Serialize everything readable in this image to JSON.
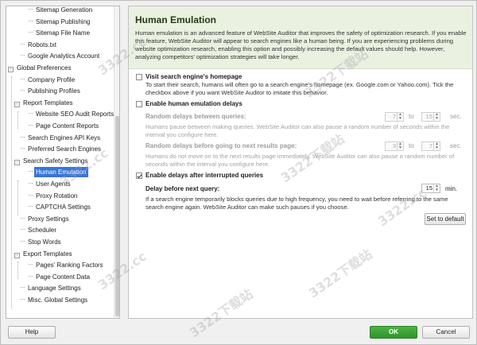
{
  "tree": [
    {
      "label": "Sitemap Generation",
      "indent": 3,
      "toggle": ""
    },
    {
      "label": "Sitemap Publishing",
      "indent": 3,
      "toggle": ""
    },
    {
      "label": "Sitemap File Name",
      "indent": 3,
      "toggle": ""
    },
    {
      "label": "Robots.txt",
      "indent": 2,
      "toggle": ""
    },
    {
      "label": "Google Analytics Account",
      "indent": 2,
      "toggle": ""
    },
    {
      "label": "Global Preferences",
      "indent": 0,
      "toggle": "-"
    },
    {
      "label": "Company Profile",
      "indent": 2,
      "toggle": ""
    },
    {
      "label": "Publishing Profiles",
      "indent": 2,
      "toggle": ""
    },
    {
      "label": "Report Templates",
      "indent": 1,
      "toggle": "-"
    },
    {
      "label": "Website SEO Audit Reports",
      "indent": 3,
      "toggle": ""
    },
    {
      "label": "Page Content Reports",
      "indent": 3,
      "toggle": ""
    },
    {
      "label": "Search Engines API Keys",
      "indent": 2,
      "toggle": ""
    },
    {
      "label": "Preferred Search Engines",
      "indent": 2,
      "toggle": ""
    },
    {
      "label": "Search Safety Settings",
      "indent": 1,
      "toggle": "-"
    },
    {
      "label": "Human Emulation",
      "indent": 3,
      "toggle": "",
      "selected": true
    },
    {
      "label": "User Agents",
      "indent": 3,
      "toggle": ""
    },
    {
      "label": "Proxy Rotation",
      "indent": 3,
      "toggle": ""
    },
    {
      "label": "CAPTCHA Settings",
      "indent": 3,
      "toggle": ""
    },
    {
      "label": "Proxy Settings",
      "indent": 2,
      "toggle": ""
    },
    {
      "label": "Scheduler",
      "indent": 2,
      "toggle": ""
    },
    {
      "label": "Stop Words",
      "indent": 2,
      "toggle": ""
    },
    {
      "label": "Export Templates",
      "indent": 1,
      "toggle": "-"
    },
    {
      "label": "Pages' Ranking Factors",
      "indent": 3,
      "toggle": ""
    },
    {
      "label": "Page Content Data",
      "indent": 3,
      "toggle": ""
    },
    {
      "label": "Language Settings",
      "indent": 2,
      "toggle": ""
    },
    {
      "label": "Misc. Global Settings",
      "indent": 2,
      "toggle": ""
    }
  ],
  "panel": {
    "title": "Human Emulation",
    "description": "Human emulation is an advanced feature of WebSite Auditor that improves the safety of optimization research. If you enable this feature, WebSite Auditor will appear to search engines like a human being. If you are experiencing problems during website optimization research, enabling this option and possibly increasing the default values should help. However, analyzing competitors' optimization strategies will take longer.",
    "visit_homepage": {
      "label": "Visit search engine's homepage",
      "checked": false,
      "help": "To start their search, humans will often go to a search engine's homepage (ex. Google.com or Yahoo.com). Tick the checkbox above if you want WebSite Auditor to imitate this behavior."
    },
    "enable_delays": {
      "label": "Enable human emulation delays",
      "checked": false
    },
    "random_between": {
      "label": "Random delays between queries:",
      "min": "7",
      "to": "to",
      "max": "15",
      "unit": "sec.",
      "help": "Humans pause between making queries. WebSite Auditor can also pause a random number of seconds within the interval you configure here."
    },
    "random_before_next": {
      "label": "Random delays before going to next results page:",
      "min": "3",
      "to": "to",
      "max": "7",
      "unit": "sec.",
      "help": "Humans do not move on to the next results page immediately. WebSite Auditor can also pause a random number of seconds within the interval you configure here."
    },
    "after_interrupted": {
      "label": "Enable delays after interrupted queries",
      "checked": true
    },
    "delay_next": {
      "label": "Delay before next query:",
      "value": "15",
      "unit": "min.",
      "help": "If a search engine  temporarily blocks queries due to high frequency, you need to wait before referring to the same search engine again. WebSite Auditor can make such pauses if you choose."
    },
    "set_default": "Set to default"
  },
  "footer": {
    "help": "Help",
    "ok": "OK",
    "cancel": "Cancel"
  },
  "colors": {
    "ok": "#34a02e",
    "selection": "#3875d7",
    "header": "#eaf1e1"
  },
  "watermarks": [
    "3322.cc",
    "3322下载站",
    "3322.cc",
    "3322下载站",
    "3322.cc",
    "3322下载站",
    "3322.cc",
    "3322下载站"
  ]
}
